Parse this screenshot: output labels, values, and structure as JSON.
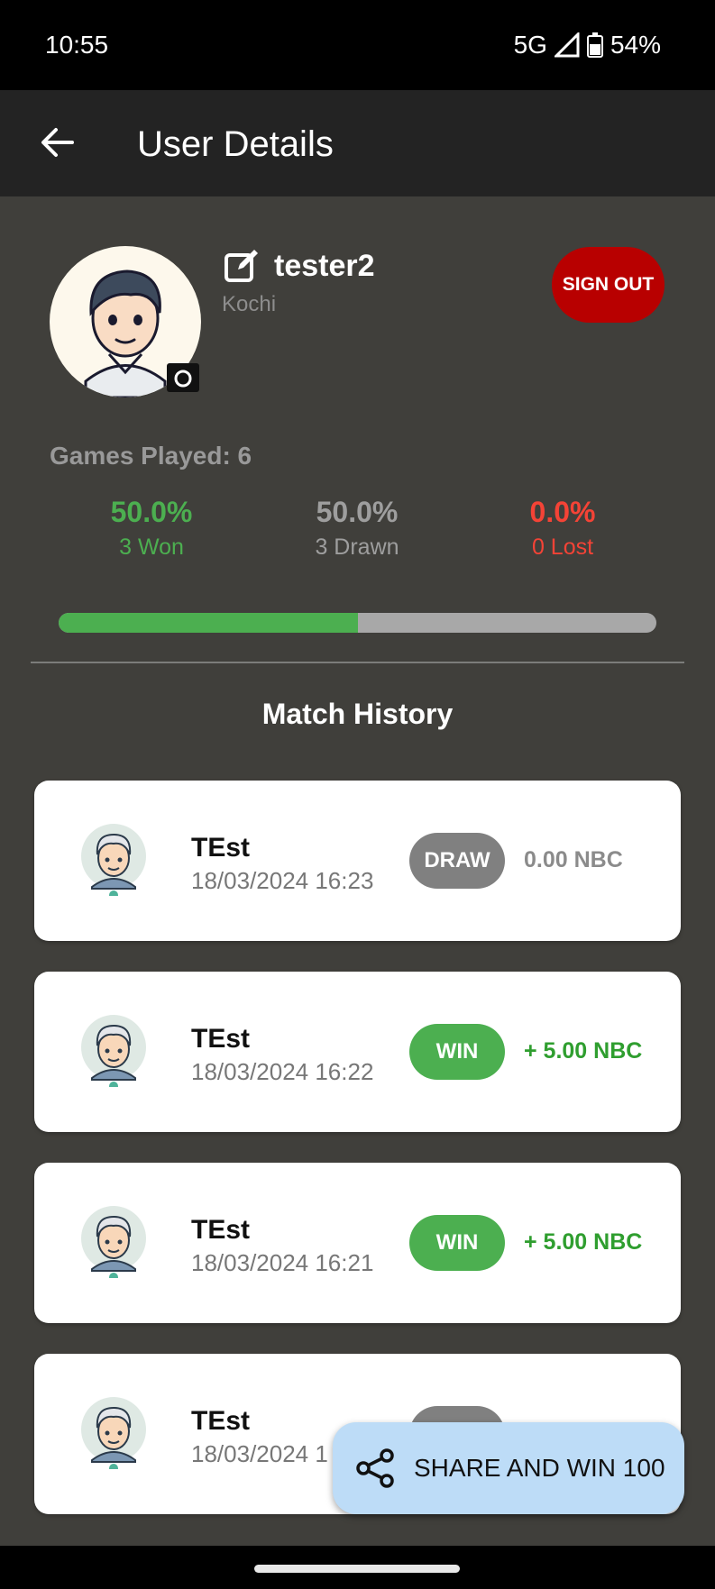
{
  "status_bar": {
    "time": "10:55",
    "network": "5G",
    "battery": "54%"
  },
  "app_bar": {
    "title": "User Details",
    "back_icon": "arrow-left-icon"
  },
  "profile": {
    "username": "tester2",
    "location": "Kochi",
    "sign_out_label": "SIGN OUT",
    "edit_icon": "edit-icon",
    "camera_icon": "camera-icon"
  },
  "stats": {
    "games_played": "Games Played: 6",
    "won": {
      "pct": "50.0%",
      "label": "3 Won",
      "color": "#4caf50"
    },
    "drawn": {
      "pct": "50.0%",
      "label": "3 Drawn",
      "color": "#9e9e9e"
    },
    "lost": {
      "pct": "0.0%",
      "label": "0 Lost",
      "color": "#f44336"
    },
    "progress_won_fraction": 0.5
  },
  "match_history": {
    "title": "Match History",
    "matches": [
      {
        "opponent": "TEst",
        "date": "18/03/2024 16:23",
        "result": "DRAW",
        "amount": "0.00 NBC",
        "kind": "draw"
      },
      {
        "opponent": "TEst",
        "date": "18/03/2024 16:22",
        "result": "WIN",
        "amount": "+ 5.00 NBC",
        "kind": "win"
      },
      {
        "opponent": "TEst",
        "date": "18/03/2024 16:21",
        "result": "WIN",
        "amount": "+ 5.00 NBC",
        "kind": "win"
      },
      {
        "opponent": "TEst",
        "date": "18/03/2024 1",
        "result": "",
        "amount": "",
        "kind": "draw"
      }
    ]
  },
  "share": {
    "label": "SHARE AND WIN 100",
    "icon": "share-icon"
  },
  "colors": {
    "app_bar": "#232323",
    "background": "#403f3b",
    "sign_out": "#b80000",
    "win": "#4caf50",
    "share_fab": "#bddcf7"
  }
}
